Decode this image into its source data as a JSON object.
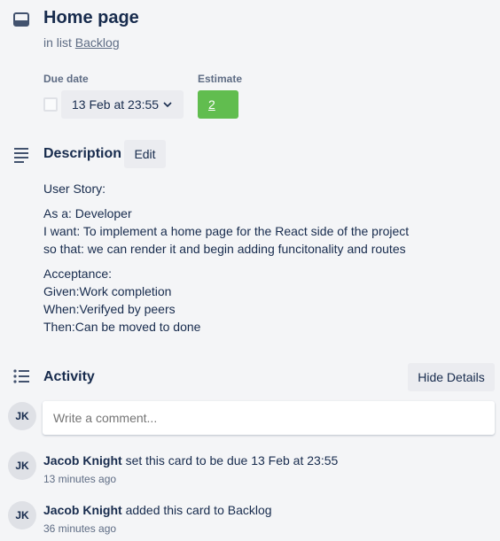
{
  "card": {
    "title": "Home page",
    "in_list_prefix": "in list",
    "list_name": "Backlog"
  },
  "due_date": {
    "label": "Due date",
    "value": "13 Feb at 23:55"
  },
  "estimate": {
    "label": "Estimate",
    "value": "2",
    "color": "#61bd4f"
  },
  "description": {
    "title": "Description",
    "edit_label": "Edit",
    "paragraphs": [
      [
        "User Story:"
      ],
      [
        "As a: Developer",
        "I want: To implement a home page for the React side of the project",
        "so that: we can render it and begin adding funcitonality and routes"
      ],
      [
        "Acceptance:",
        "Given:Work completion",
        "When:Verifyed by peers",
        "Then:Can be moved to done"
      ]
    ]
  },
  "activity": {
    "title": "Activity",
    "hide_details_label": "Hide Details",
    "comment_placeholder": "Write a comment...",
    "avatar_initials": "JK",
    "items": [
      {
        "initials": "JK",
        "user": "Jacob Knight",
        "action": "set this card to be due 13 Feb at 23:55",
        "time": "13 minutes ago"
      },
      {
        "initials": "JK",
        "user": "Jacob Knight",
        "action": "added this card to Backlog",
        "time": "36 minutes ago"
      }
    ]
  },
  "icons": [
    "card-icon",
    "chevron-down-icon",
    "description-icon",
    "activity-icon"
  ]
}
